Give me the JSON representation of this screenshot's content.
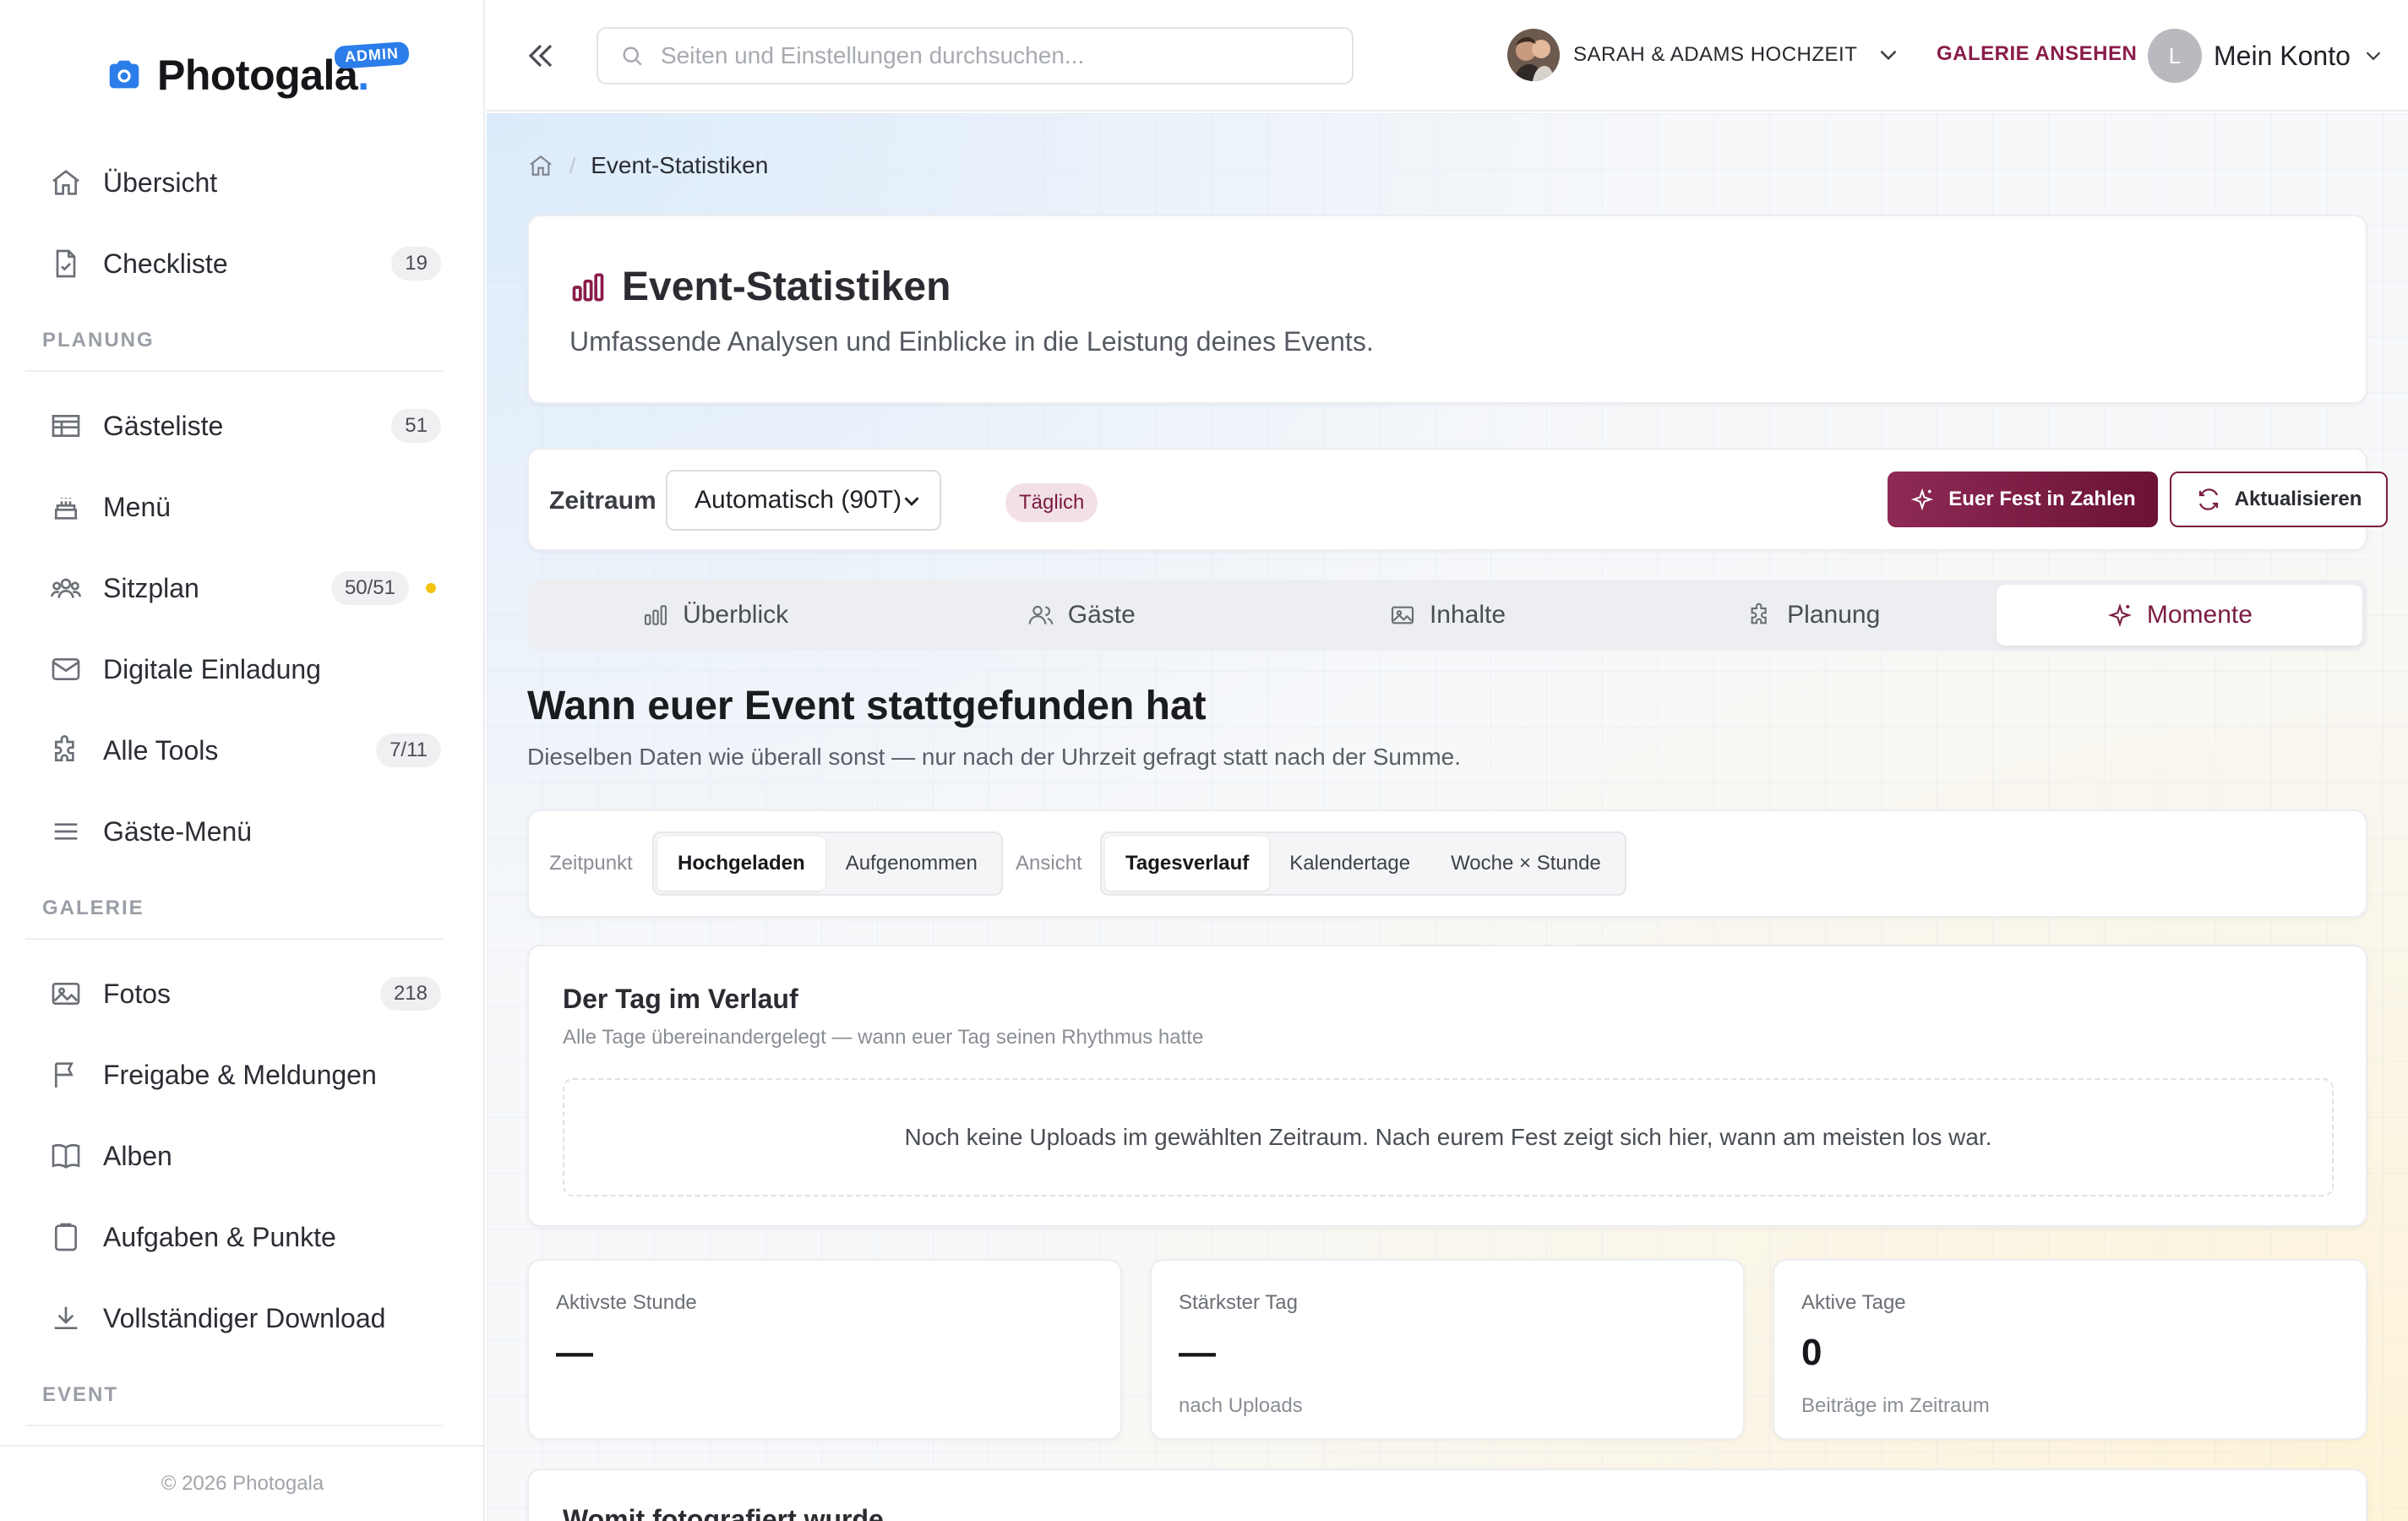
{
  "brand": {
    "name": "Photogala",
    "badge": "ADMIN"
  },
  "sidebar": {
    "items": [
      {
        "label": "Übersicht",
        "icon": "home-icon"
      },
      {
        "label": "Checkliste",
        "icon": "checklist-icon",
        "count": "19"
      }
    ],
    "sections": [
      {
        "title": "PLANUNG",
        "items": [
          {
            "label": "Gästeliste",
            "icon": "table-icon",
            "count": "51"
          },
          {
            "label": "Menü",
            "icon": "cake-icon"
          },
          {
            "label": "Sitzplan",
            "icon": "users-icon",
            "count": "50/51",
            "status_color": "#f1c40f"
          },
          {
            "label": "Digitale Einladung",
            "icon": "mail-icon"
          },
          {
            "label": "Alle Tools",
            "icon": "puzzle-icon",
            "count": "7/11"
          },
          {
            "label": "Gäste-Menü",
            "icon": "menu-icon"
          }
        ]
      },
      {
        "title": "GALERIE",
        "items": [
          {
            "label": "Fotos",
            "icon": "image-icon",
            "count": "218"
          },
          {
            "label": "Freigabe & Meldungen",
            "icon": "flag-icon"
          },
          {
            "label": "Alben",
            "icon": "book-icon"
          },
          {
            "label": "Aufgaben & Punkte",
            "icon": "clipboard-icon"
          },
          {
            "label": "Vollständiger Download",
            "icon": "download-icon"
          }
        ]
      },
      {
        "title": "EVENT",
        "items": []
      }
    ],
    "footer": "© 2026 Photogala"
  },
  "topbar": {
    "search_placeholder": "Seiten und Einstellungen durchsuchen...",
    "event_name": "SARAH & ADAMS HOCHZEIT",
    "gallery_link": "GALERIE ANSEHEN",
    "account_initial": "L",
    "account_label": "Mein Konto"
  },
  "breadcrumb": {
    "current": "Event-Statistiken"
  },
  "header": {
    "title": "Event-Statistiken",
    "subtitle": "Umfassende Analysen und Einblicke in die Leistung deines Events."
  },
  "filters": {
    "period_label": "Zeitraum",
    "period_value": "Automatisch (90T)",
    "granularity": "Täglich",
    "primary_button": "Euer Fest in Zahlen",
    "refresh_button": "Aktualisieren"
  },
  "tabs": [
    {
      "label": "Überblick",
      "icon": "bar-chart-icon"
    },
    {
      "label": "Gäste",
      "icon": "users-icon"
    },
    {
      "label": "Inhalte",
      "icon": "image-icon"
    },
    {
      "label": "Planung",
      "icon": "puzzle-icon"
    },
    {
      "label": "Momente",
      "icon": "sparkle-icon",
      "active": true
    }
  ],
  "moments": {
    "title": "Wann euer Event stattgefunden hat",
    "subtitle": "Dieselben Daten wie überall sonst — nur nach der Uhrzeit gefragt statt nach der Summe.",
    "zeitpunkt_label": "Zeitpunkt",
    "zeitpunkt_options": [
      "Hochgeladen",
      "Aufgenommen"
    ],
    "zeitpunkt_selected": "Hochgeladen",
    "ansicht_label": "Ansicht",
    "ansicht_options": [
      "Tagesverlauf",
      "Kalendertage",
      "Woche × Stunde"
    ],
    "ansicht_selected": "Tagesverlauf",
    "day_card": {
      "title": "Der Tag im Verlauf",
      "subtitle": "Alle Tage übereinandergelegt — wann euer Tag seinen Rhythmus hatte",
      "empty": "Noch keine Uploads im gewählten Zeitraum. Nach eurem Fest zeigt sich hier, wann am meisten los war."
    },
    "stats": [
      {
        "label": "Aktivste Stunde",
        "value": "—",
        "note": ""
      },
      {
        "label": "Stärkster Tag",
        "value": "—",
        "note": "nach Uploads"
      },
      {
        "label": "Aktive Tage",
        "value": "0",
        "note": "Beiträge im Zeitraum"
      }
    ],
    "next_section_title": "Womit fotografiert wurde"
  },
  "colors": {
    "brand": "#2b7de9",
    "accent": "#7a1b42",
    "status_dot": "#f1c40f"
  }
}
